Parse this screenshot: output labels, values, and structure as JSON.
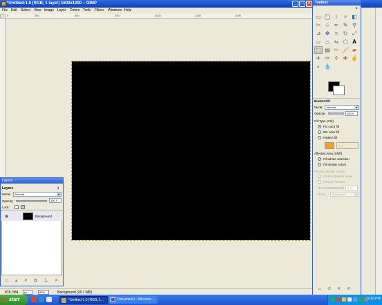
{
  "main_window": {
    "title": "*Untitled-1.0 (RGB, 1 layer) 1600x1200 – GIMP",
    "menus": [
      "File",
      "Edit",
      "Select",
      "View",
      "Image",
      "Layer",
      "Colors",
      "Tools",
      "Filters",
      "Windows",
      "Help"
    ],
    "ruler_ticks": [
      "0",
      "250",
      "500",
      "750",
      "1000",
      "1250",
      "1500"
    ],
    "status": {
      "coords": "878, 584",
      "unit": "px",
      "zoom": "50%",
      "info": "Background (26.1 MB)"
    }
  },
  "layers": {
    "window_title": "Layers",
    "panel_title": "Layers",
    "mode_label": "Mode:",
    "mode_value": "Normal",
    "opacity_label": "Opacity:",
    "opacity_value": "100.0",
    "lock_label": "Lock:",
    "layer_name": "Background"
  },
  "toolbox": {
    "title": "Toolbox",
    "tool_options_title": "Bucket Fill",
    "mode_label": "Mode:",
    "mode_value": "Normal",
    "opacity_label": "Opacity:",
    "opacity_value": "100.0",
    "fill_type_label": "Fill Type (Ctrl)",
    "fill_options": [
      "FG color fill",
      "BG color fill",
      "Pattern fill"
    ],
    "fill_selected": 0,
    "pattern_name": "Pine",
    "affected_area_label": "Affected Area (Shift)",
    "area_options": [
      "Fill whole selection",
      "Fill similar colors"
    ],
    "area_selected": 0,
    "finding_label": "Finding Similar Colors",
    "fill_transparent": "Fill transparent areas",
    "sample_merged": "Sample merged",
    "threshold_label": "Threshold:",
    "threshold_value": "15.0",
    "fill_by_label": "Fill by:",
    "fill_by_value": "Composite"
  },
  "taskbar": {
    "start_label": "start",
    "tasks": [
      "*Untitled-1.0 (RGB, 1...",
      "Document1 - Microsof..."
    ],
    "clock": "9:19 PM"
  },
  "colors": {
    "titlebar": "#2a5fd6",
    "canvas_bg": "#ece9d8",
    "image": "#000000",
    "taskbar": "#245edb",
    "start": "#3c9a36"
  }
}
